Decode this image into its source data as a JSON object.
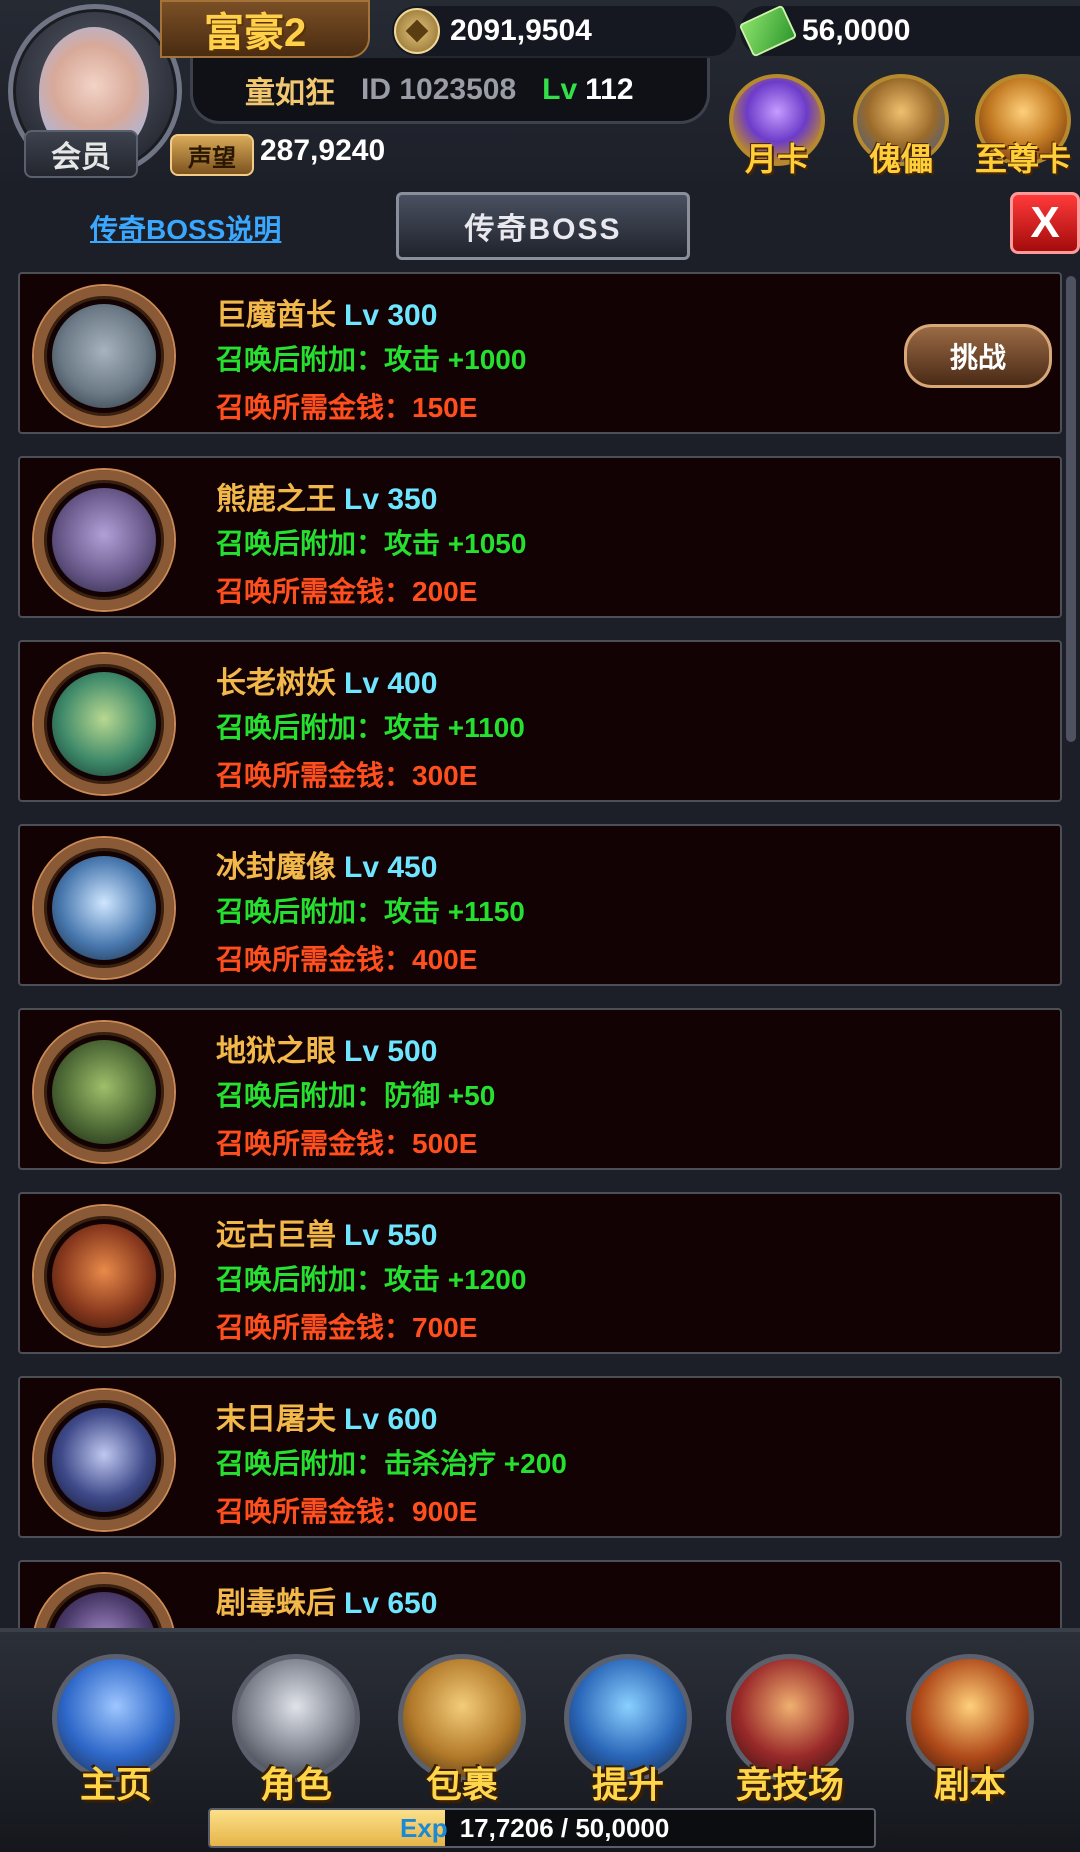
{
  "header": {
    "vip_label": "会员",
    "rich_label": "富豪2",
    "gold": "2091,9504",
    "cash": "56,0000",
    "player_name": "童如狂",
    "player_id": "ID 1023508",
    "lv_label": "Lv",
    "lv_value": "112",
    "reputation_label": "声望",
    "reputation_value": "287,9240",
    "cards": [
      {
        "label": "月卡",
        "icon": "diamond-crown-icon"
      },
      {
        "label": "傀儡",
        "icon": "golden-helmet-icon"
      },
      {
        "label": "至尊卡",
        "icon": "lion-icon"
      }
    ]
  },
  "toolbar": {
    "help_link": "传奇BOSS说明",
    "title": "传奇BOSS",
    "close_label": "X"
  },
  "bosses": [
    {
      "name": "巨魔酋长",
      "lv": "Lv 300",
      "bonus": "召唤后附加：攻击 +1000",
      "cost": "召唤所需金钱：150E",
      "challenge": "挑战",
      "color": "#6b7a86"
    },
    {
      "name": "熊鹿之王",
      "lv": "Lv 350",
      "bonus": "召唤后附加：攻击 +1050",
      "cost": "召唤所需金钱：200E",
      "color": "#6a5a8c"
    },
    {
      "name": "长老树妖",
      "lv": "Lv 400",
      "bonus": "召唤后附加：攻击 +1100",
      "cost": "召唤所需金钱：300E",
      "color": "#3f8a6a"
    },
    {
      "name": "冰封魔像",
      "lv": "Lv 450",
      "bonus": "召唤后附加：攻击 +1150",
      "cost": "召唤所需金钱：400E",
      "color": "#4a7ab0"
    },
    {
      "name": "地狱之眼",
      "lv": "Lv 500",
      "bonus": "召唤后附加：防御 +50",
      "cost": "召唤所需金钱：500E",
      "color": "#4e6a36"
    },
    {
      "name": "远古巨兽",
      "lv": "Lv 550",
      "bonus": "召唤后附加：攻击 +1200",
      "cost": "召唤所需金钱：700E",
      "color": "#8a3a1e"
    },
    {
      "name": "末日屠夫",
      "lv": "Lv 600",
      "bonus": "召唤后附加：击杀治疗 +200",
      "cost": "召唤所需金钱：900E",
      "color": "#3f4a8a"
    },
    {
      "name": "剧毒蛛后",
      "lv": "Lv 650",
      "bonus": "",
      "cost": "",
      "color": "#4a3a6a"
    }
  ],
  "nav": [
    {
      "label": "主页",
      "icon": "flag-icon",
      "color": "#2e68c9"
    },
    {
      "label": "角色",
      "icon": "helmet-icon",
      "color": "#7a7f8a"
    },
    {
      "label": "包裹",
      "icon": "bag-icon",
      "color": "#b27a2a"
    },
    {
      "label": "提升",
      "icon": "upgrade-gem-icon",
      "color": "#2a66b8"
    },
    {
      "label": "竞技场",
      "icon": "shield-icon",
      "color": "#9a2a2a"
    },
    {
      "label": "剧本",
      "icon": "skull-icon",
      "color": "#b04a1a"
    }
  ],
  "exp": {
    "label": "Exp",
    "value": "17,7206 / 50,0000",
    "current": 177206,
    "max": 500000
  }
}
